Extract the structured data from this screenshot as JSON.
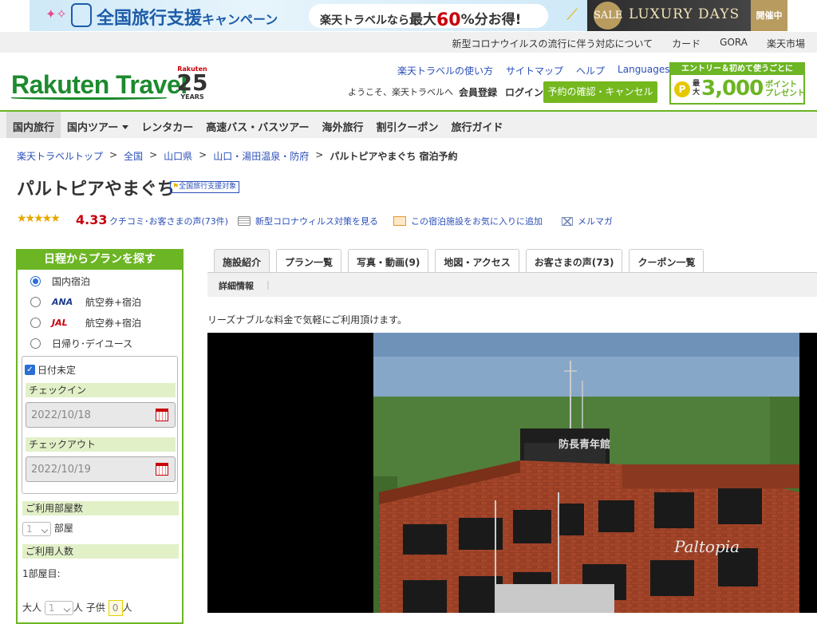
{
  "promo": {
    "title_main": "全国旅行支援",
    "title_sub": "キャンペーン",
    "pill_prefix": "楽天トラベルなら",
    "pill_max": "最大",
    "pill_percent": "60",
    "pill_pct_sign": "%",
    "pill_suffix": "分お得!",
    "sale": "SALE",
    "luxury": "LUXURY DAYS",
    "kaisai": "開催中"
  },
  "util_links": [
    "新型コロナウイルスの流行に伴う対応について",
    "カード",
    "GORA",
    "楽天市場"
  ],
  "header": {
    "logo": "Rakuten Travel",
    "anniv_brand": "Rakuten",
    "anniv_number": "25",
    "anniv_years": "YEARS",
    "links": [
      "楽天トラベルの使い方",
      "サイトマップ",
      "ヘルプ",
      "Languages"
    ],
    "welcome": "ようこそ、楽天トラベルへ",
    "member": "会員登録",
    "login": "ログイン",
    "confirm_button": "予約の確認・キャンセル",
    "entry_top": "エントリー＆初めて使うごとに",
    "entry_max": "最大",
    "entry_number": "3,000",
    "entry_pt": "ポイント プレゼント"
  },
  "nav": [
    "国内旅行",
    "国内ツアー",
    "レンタカー",
    "高速バス・バスツアー",
    "海外旅行",
    "割引クーポン",
    "旅行ガイド"
  ],
  "breadcrumb": [
    "楽天トラベルトップ",
    "全国",
    "山口県",
    "山口・湯田温泉・防府"
  ],
  "breadcrumb_current": "パルトピアやまぐち 宿泊予約",
  "breadcrumb_sep": ">",
  "hotel": {
    "name": "パルトピアやまぐち",
    "badge": "全国旅行支援対象",
    "rating": "4.33",
    "review_link": "クチコミ･お客さまの声(73件)",
    "covid_link": "新型コロナウィルス対策を見る",
    "fav_link": "この宿泊施設をお気に入りに追加",
    "mail_link": "メルマガ",
    "description": "リーズナブルな料金で気軽にご利用頂けます。"
  },
  "sidebar": {
    "heading": "日程からプランを探す",
    "options": [
      {
        "brand": "",
        "label": "国内宿泊",
        "selected": true
      },
      {
        "brand": "ANA",
        "label": "航空券+宿泊",
        "selected": false
      },
      {
        "brand": "JAL",
        "label": "航空券+宿泊",
        "selected": false
      },
      {
        "brand": "",
        "label": "日帰り･デイユース",
        "selected": false
      }
    ],
    "undecided_label": "日付未定",
    "checkin_label": "チェックイン",
    "checkin_value": "2022/10/18",
    "checkout_label": "チェックアウト",
    "checkout_value": "2022/10/19",
    "rooms_label": "ご利用部屋数",
    "rooms_value": "1",
    "rooms_unit": "部屋",
    "guests_label": "ご利用人数",
    "room1_label": "1部屋目:",
    "adult_label": "大人",
    "adult_value": "1",
    "person_unit": "人",
    "child_label": "子供",
    "child_value": "0"
  },
  "tabs": [
    "施設紹介",
    "プラン一覧",
    "写真・動画(9)",
    "地図・アクセス",
    "お客さまの声(73)",
    "クーポン一覧"
  ],
  "subtab": "詳細情報",
  "photo_sign": "防長青年館",
  "photo_script": "Paltopia"
}
